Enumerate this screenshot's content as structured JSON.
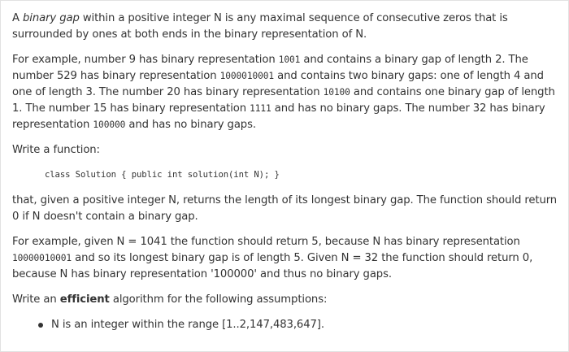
{
  "intro": {
    "term": "binary gap",
    "before_term": "A ",
    "after_term": " within a positive integer N is any maximal sequence of consecutive zeros that is surrounded by ones at both ends in the binary representation of N."
  },
  "example": {
    "t1": "For example, number 9 has binary representation ",
    "c1": "1001",
    "t2": " and contains a binary gap of length 2. The number 529 has binary representation ",
    "c2": "1000010001",
    "t3": " and contains two binary gaps: one of length 4 and one of length 3. The number 20 has binary representation ",
    "c3": "10100",
    "t4": " and contains one binary gap of length 1. The number 15 has binary representation ",
    "c4": "1111",
    "t5": " and has no binary gaps. The number 32 has binary representation ",
    "c5": "100000",
    "t6": " and has no binary gaps."
  },
  "write_function": "Write a function:",
  "signature": "class Solution { public int solution(int N); }",
  "task": "that, given a positive integer N, returns the length of its longest binary gap. The function should return 0 if N doesn't contain a binary gap.",
  "example2": {
    "t1": "For example, given N = 1041 the function should return 5, because N has binary representation ",
    "c1": "10000010001",
    "t2": " and so its longest binary gap is of length 5. Given N = 32 the function should return 0, because N has binary representation '100000' and thus no binary gaps."
  },
  "assumptions": {
    "before": "Write an ",
    "emphasis": "efficient",
    "after": " algorithm for the following assumptions:",
    "items": [
      "N is an integer within the range [1..2,147,483,647]."
    ]
  }
}
